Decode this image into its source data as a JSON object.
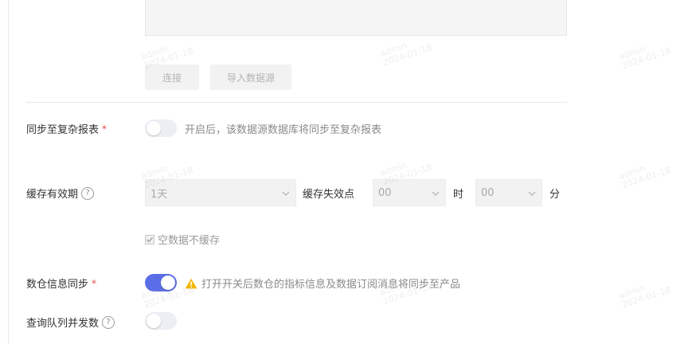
{
  "form": {
    "connect_button": "连接",
    "import_button": "导入数据源",
    "sync_report": {
      "label": "同步至复杂报表",
      "required_mark": "*",
      "enabled": false,
      "hint": "开启后，该数据源数据库将同步至复杂报表"
    },
    "cache": {
      "label": "缓存有效期",
      "help": "?",
      "valid_value": "1天",
      "expire_label": "缓存失效点",
      "hour_value": "00",
      "hour_unit": "时",
      "minute_value": "00",
      "minute_unit": "分",
      "no_cache_empty_label": "空数据不缓存",
      "no_cache_empty_checked": true
    },
    "warehouse_sync": {
      "label": "数仓信息同步",
      "required_mark": "*",
      "enabled": true,
      "hint": "打开开关后数仓的指标信息及数据订阅消息将同步至产品"
    },
    "query_concurrency": {
      "label": "查询队列并发数",
      "help": "?",
      "enabled": false
    }
  },
  "watermark": {
    "user": "admin",
    "date": "2024-01-18"
  },
  "colors": {
    "toggle_on": "#5b6ee8",
    "warning": "#f2b705",
    "required": "#e64a4a"
  }
}
